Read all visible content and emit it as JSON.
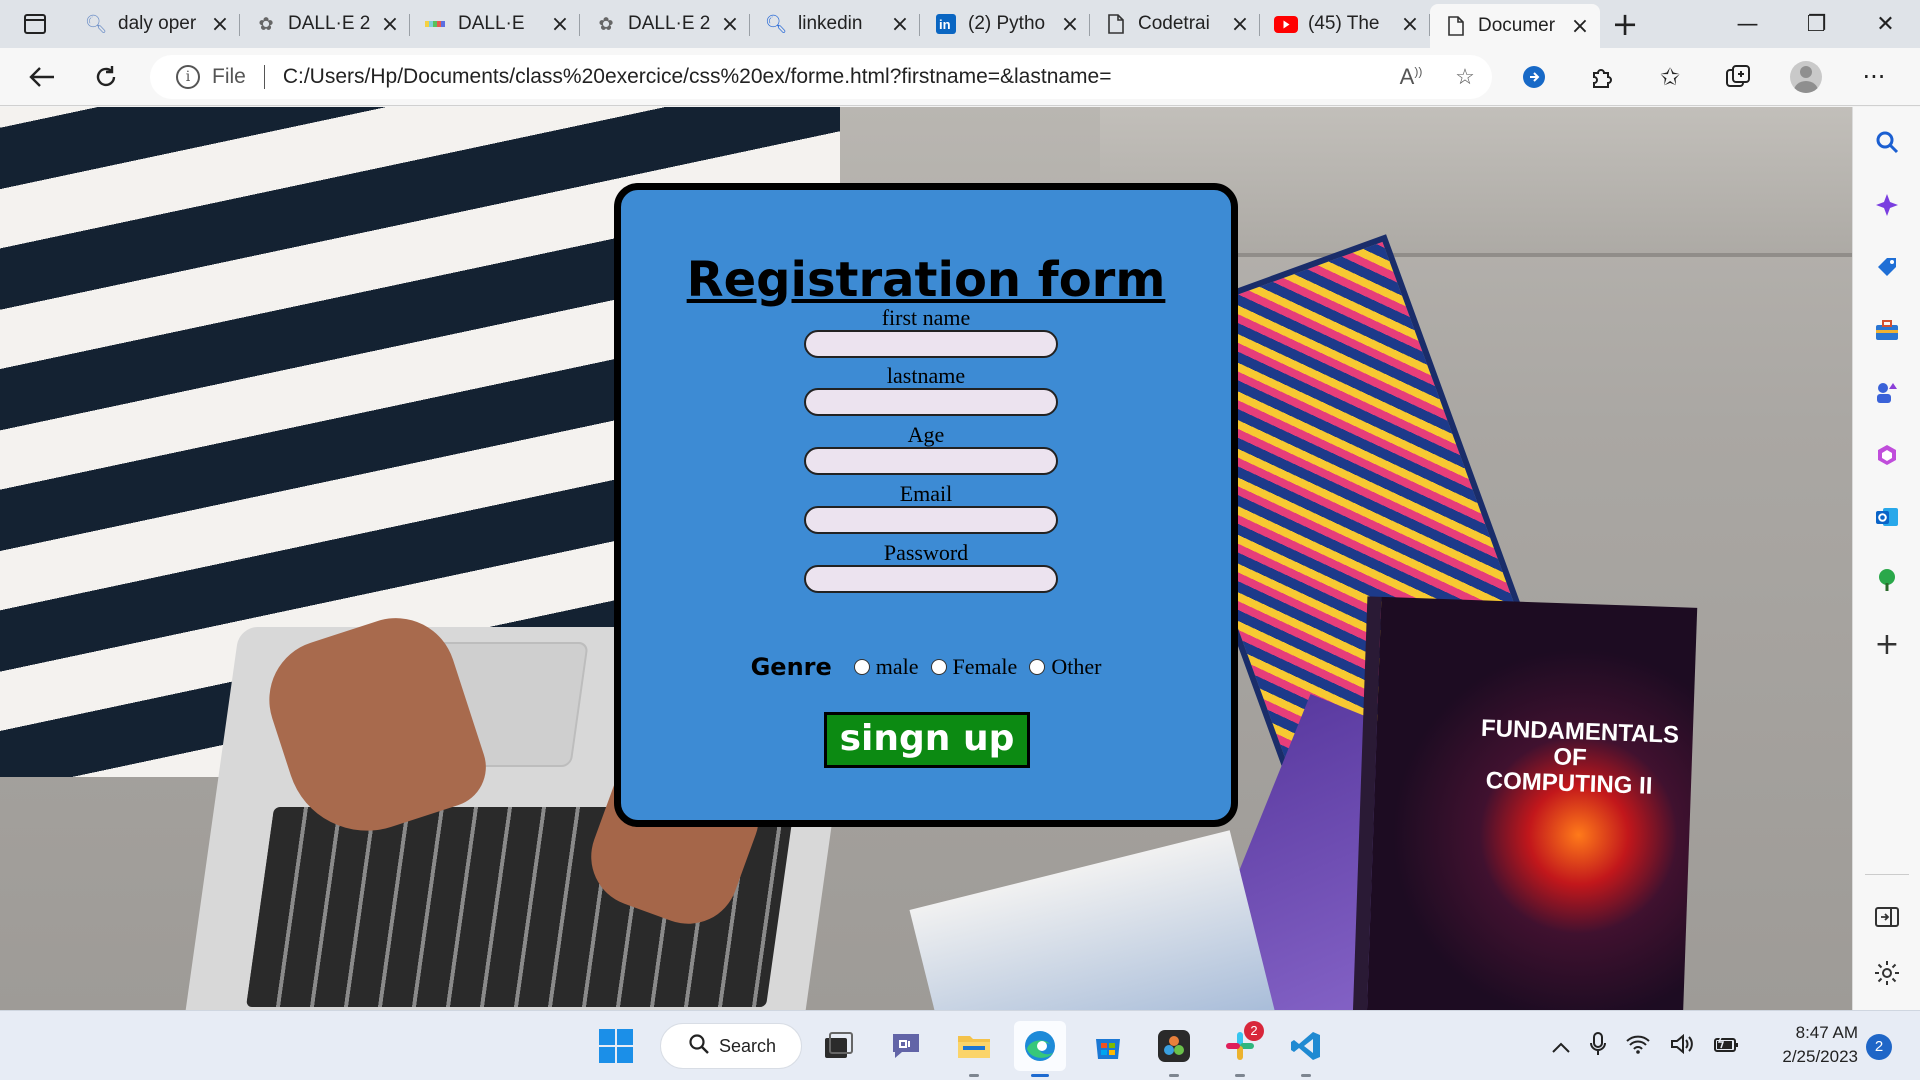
{
  "browser": {
    "tabs": [
      {
        "title": "daly oper",
        "icon": "search-icon"
      },
      {
        "title": "DALL·E 2",
        "icon": "openai-icon"
      },
      {
        "title": "DALL·E",
        "icon": "dalle-icon"
      },
      {
        "title": "DALL·E 2",
        "icon": "openai-icon"
      },
      {
        "title": "linkedin",
        "icon": "search-icon"
      },
      {
        "title": "(2) Pytho",
        "icon": "linkedin-icon"
      },
      {
        "title": "Codetrai",
        "icon": "page-icon"
      },
      {
        "title": "(45) The",
        "icon": "youtube-icon"
      },
      {
        "title": "Documer",
        "icon": "page-icon",
        "active": true
      }
    ],
    "address": {
      "scheme_label": "File",
      "url": "C:/Users/Hp/Documents/class%20exercice/css%20ex/forme.html?firstname=&lastname="
    }
  },
  "form": {
    "title": "Registration form",
    "fields": [
      {
        "label": "first name",
        "value": ""
      },
      {
        "label": "lastname",
        "value": ""
      },
      {
        "label": "Age",
        "value": ""
      },
      {
        "label": "Email",
        "value": ""
      },
      {
        "label": "Password",
        "value": ""
      }
    ],
    "genre": {
      "label": "Genre",
      "options": [
        "male",
        "Female",
        "Other"
      ]
    },
    "submit_label": "singn up"
  },
  "background_book": {
    "title": "FUNDAMENTALS OF COMPUTING II"
  },
  "taskbar": {
    "search_label": "Search",
    "time": "8:47 AM",
    "date": "2/25/2023",
    "notification_count": "2",
    "slack_badge": "2"
  },
  "colors": {
    "form_bg": "#3d8bd4",
    "submit_bg": "#0c8a12",
    "input_bg": "#ece3ef"
  }
}
